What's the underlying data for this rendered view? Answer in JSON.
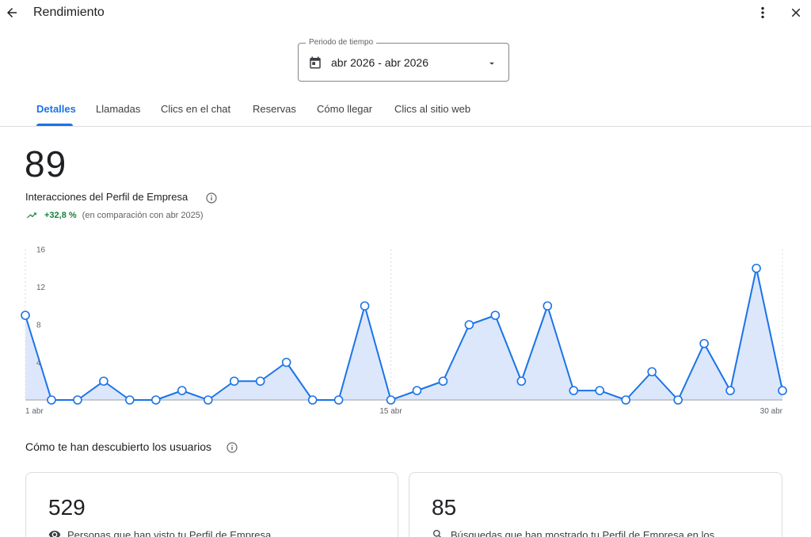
{
  "header": {
    "title": "Rendimiento",
    "back_icon": "arrow-back-icon",
    "more_icon": "more-vert-icon",
    "close_icon": "close-icon"
  },
  "period": {
    "label": "Periodo de tiempo",
    "value": "abr 2026 - abr 2026",
    "icon": "calendar-icon"
  },
  "tabs": [
    {
      "label": "Detalles",
      "active": true
    },
    {
      "label": "Llamadas",
      "active": false
    },
    {
      "label": "Clics en el chat",
      "active": false
    },
    {
      "label": "Reservas",
      "active": false
    },
    {
      "label": "Cómo llegar",
      "active": false
    },
    {
      "label": "Clics al sitio web",
      "active": false
    }
  ],
  "summary": {
    "total": "89",
    "label": "Interacciones del Perfil de Empresa",
    "change": "+32,8 %",
    "comparison": "(en comparación con abr 2025)"
  },
  "chart_data": {
    "type": "area",
    "x": [
      "1 abr",
      "2 abr",
      "3 abr",
      "4 abr",
      "5 abr",
      "6 abr",
      "7 abr",
      "8 abr",
      "9 abr",
      "10 abr",
      "11 abr",
      "12 abr",
      "13 abr",
      "14 abr",
      "15 abr",
      "16 abr",
      "17 abr",
      "18 abr",
      "19 abr",
      "20 abr",
      "21 abr",
      "22 abr",
      "23 abr",
      "24 abr",
      "25 abr",
      "26 abr",
      "27 abr",
      "28 abr",
      "29 abr",
      "30 abr"
    ],
    "series": [
      {
        "values": [
          9,
          0,
          0,
          2,
          0,
          0,
          1,
          0,
          2,
          2,
          4,
          0,
          0,
          10,
          0,
          1,
          2,
          8,
          9,
          2,
          10,
          1,
          1,
          0,
          3,
          0,
          6,
          1,
          14,
          1
        ]
      }
    ],
    "x_ticks": [
      "1 abr",
      "15 abr",
      "30 abr"
    ],
    "y_ticks": [
      "4",
      "8",
      "12",
      "16"
    ],
    "ylim": [
      0,
      16
    ],
    "line_color": "#1a73e8",
    "fill_color": "#dce7fb"
  },
  "discovery": {
    "title": "Cómo te han descubierto los usuarios",
    "cards": [
      {
        "value": "529",
        "label": "Personas que han visto tu Perfil de Empresa",
        "icon": "eye-icon"
      },
      {
        "value": "85",
        "label": "Búsquedas que han mostrado tu Perfil de Empresa en los",
        "icon": "search-icon"
      }
    ]
  },
  "colors": {
    "accent": "#1a73e8",
    "positive": "#188038"
  }
}
